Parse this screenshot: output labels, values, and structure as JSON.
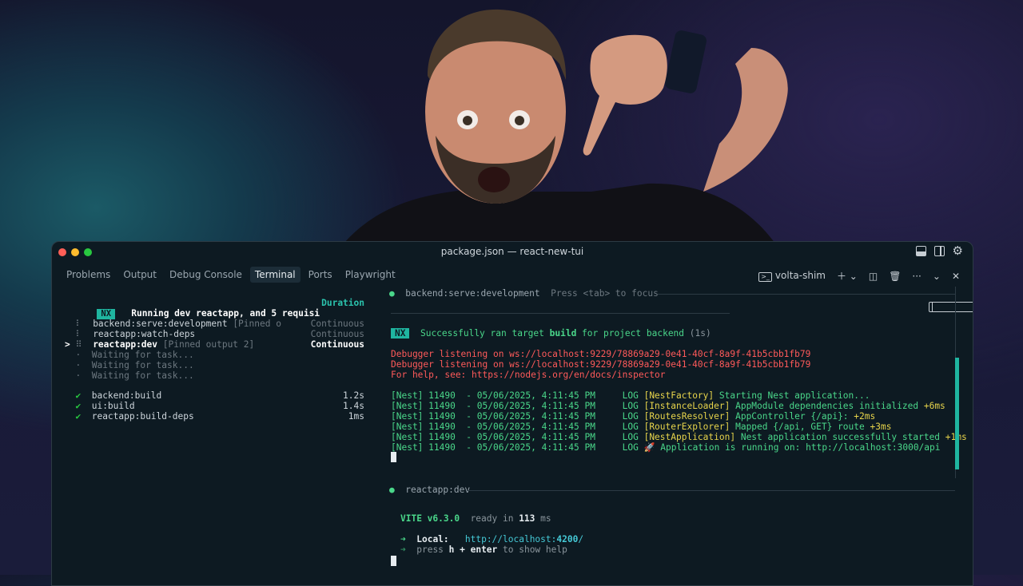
{
  "window": {
    "title": "package.json — react-new-tui"
  },
  "panel_tabs": [
    "Problems",
    "Output",
    "Debug Console",
    "Terminal",
    "Ports",
    "Playwright"
  ],
  "panel_actions": {
    "shell": "volta-shim"
  },
  "tasks": {
    "badge": "NX",
    "heading": "Running dev reactapp, and 5 requisi",
    "duration_header": "Duration",
    "running": [
      {
        "marker": " ",
        "icon": "⠇",
        "name": "backend:serve:development",
        "note": " [Pinned o",
        "duration": "Continuous",
        "dim": false,
        "selected": false
      },
      {
        "marker": " ",
        "icon": "⠇",
        "name": "reactapp:watch-deps",
        "note": "",
        "duration": "Continuous",
        "dim": false,
        "selected": false
      },
      {
        "marker": ">",
        "icon": "⠿",
        "name": "reactapp:dev",
        "note": " [Pinned output 2]",
        "duration": "Continuous",
        "dim": false,
        "selected": true
      },
      {
        "marker": " ",
        "icon": "·",
        "name": "Waiting for task...",
        "note": "",
        "duration": "",
        "dim": true,
        "selected": false
      },
      {
        "marker": " ",
        "icon": "·",
        "name": "Waiting for task...",
        "note": "",
        "duration": "",
        "dim": true,
        "selected": false
      },
      {
        "marker": " ",
        "icon": "·",
        "name": "Waiting for task...",
        "note": "",
        "duration": "",
        "dim": true,
        "selected": false
      }
    ],
    "completed": [
      {
        "icon": "✔",
        "name": "backend:build",
        "duration": "1.2s"
      },
      {
        "icon": "✔",
        "name": "ui:build",
        "duration": "1.4s"
      },
      {
        "icon": "✔",
        "name": "reactapp:build-deps",
        "duration": "1ms"
      }
    ]
  },
  "pane1": {
    "header": "backend:serve:development",
    "hint": "Press <tab> to focus",
    "nx_badge": "NX",
    "success_pre": "Successfully ran target ",
    "success_target": "build",
    "success_post": " for project backend ",
    "success_time": "(1s)",
    "debug_lines": [
      "Debugger listening on ws://localhost:9229/78869a29-0e41-40cf-8a9f-41b5cbb1fb79",
      "Debugger listening on ws://localhost:9229/78869a29-0e41-40cf-8a9f-41b5cbb1fb79",
      "For help, see: https://nodejs.org/en/docs/inspector"
    ],
    "nest_logs": [
      {
        "prefix": "[Nest] 11490  - 05/06/2025, 4:11:45 PM     LOG ",
        "ctx": "[NestFactory]",
        "msg": " Starting Nest application...",
        "time": ""
      },
      {
        "prefix": "[Nest] 11490  - 05/06/2025, 4:11:45 PM     LOG ",
        "ctx": "[InstanceLoader]",
        "msg": " AppModule dependencies initialized ",
        "time": "+6ms"
      },
      {
        "prefix": "[Nest] 11490  - 05/06/2025, 4:11:45 PM     LOG ",
        "ctx": "[RoutesResolver]",
        "msg": " AppController {/api}: ",
        "time": "+2ms"
      },
      {
        "prefix": "[Nest] 11490  - 05/06/2025, 4:11:45 PM     LOG ",
        "ctx": "[RouterExplorer]",
        "msg": " Mapped {/api, GET} route ",
        "time": "+3ms"
      },
      {
        "prefix": "[Nest] 11490  - 05/06/2025, 4:11:45 PM     LOG ",
        "ctx": "[NestApplication]",
        "msg": " Nest application successfully started ",
        "time": "+1ms"
      },
      {
        "prefix": "[Nest] 11490  - 05/06/2025, 4:11:45 PM     LOG ",
        "ctx": "🚀",
        "msg": " Application is running on: http://localhost:3000/api",
        "time": ""
      }
    ]
  },
  "pane2": {
    "header": "reactapp:dev",
    "vite": "VITE v6.3.0",
    "ready_pre": "  ready in ",
    "ready_ms": "113",
    "ready_post": " ms",
    "local_arrow": "➜",
    "local_label": "Local:",
    "local_url_pre": "http://localhost:",
    "local_port": "4200",
    "local_url_post": "/",
    "help_pre": "press ",
    "help_key": "h + enter",
    "help_post": " to show help"
  }
}
